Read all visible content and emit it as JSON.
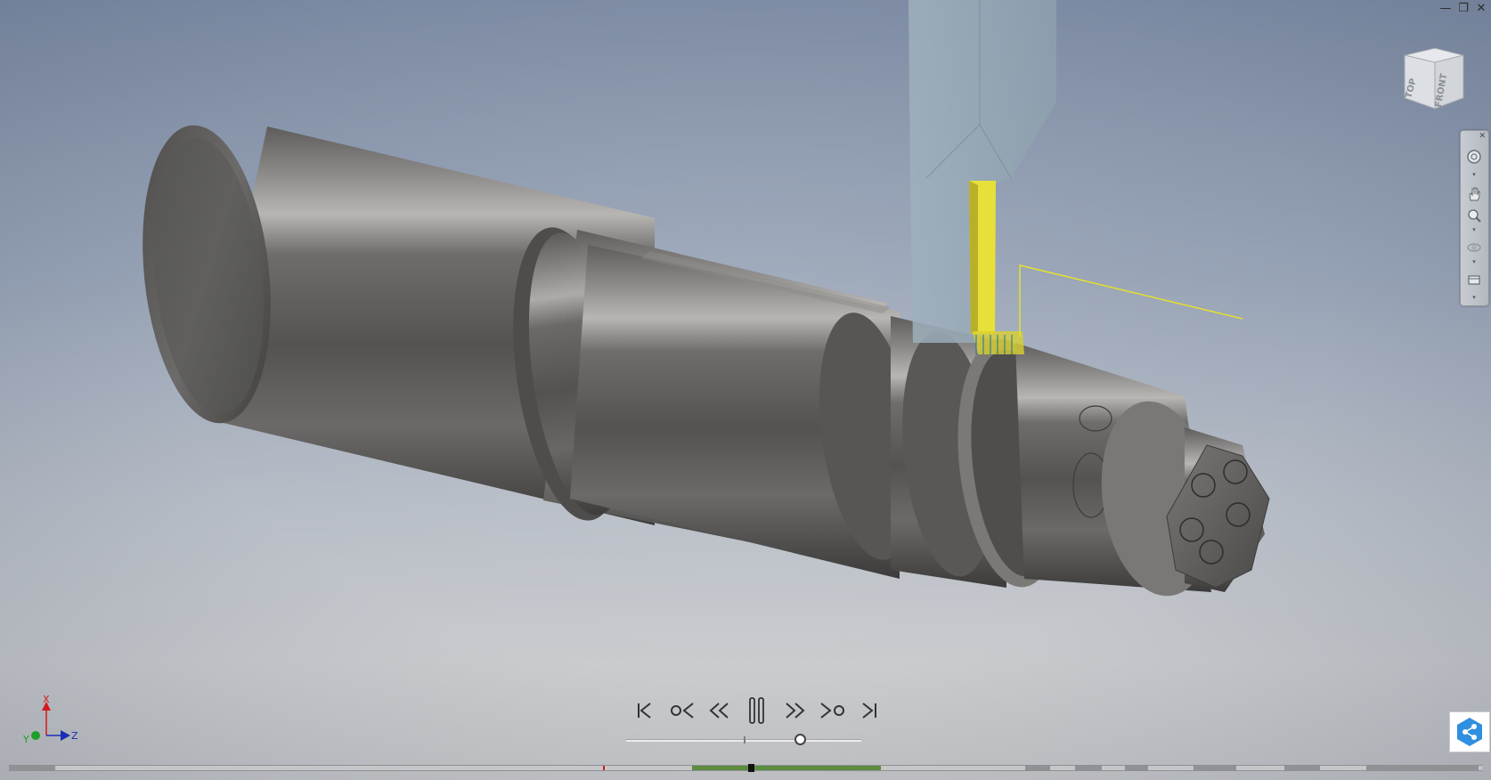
{
  "window_controls": {
    "minimize": "—",
    "restore": "❐",
    "close": "✕"
  },
  "viewcube": {
    "top_label": "TOP",
    "front_label": "FRONT"
  },
  "triad": {
    "x_label": "X",
    "y_label": "Y",
    "z_label": "Z",
    "x_color": "#d11b1b",
    "y_color": "#1f9e2a",
    "z_color": "#1a2fb5"
  },
  "navbar": {
    "items": [
      "steering-wheel-icon",
      "pan-icon",
      "zoom-icon",
      "orbit-icon",
      "look-at-icon"
    ]
  },
  "playback": {
    "buttons": [
      "skip-to-start-icon",
      "step-back-icon",
      "rewind-icon",
      "pause-icon",
      "fast-forward-icon",
      "step-forward-icon",
      "skip-to-end-icon"
    ],
    "speed_level": 0.74
  },
  "timeline": {
    "progress_color": "#5c8d3f",
    "marker_color": "#d11b1b"
  },
  "colors": {
    "tool_highlight": "#e8e03a",
    "toolpath": "#e6e02c",
    "accent": "#1e88e5"
  }
}
